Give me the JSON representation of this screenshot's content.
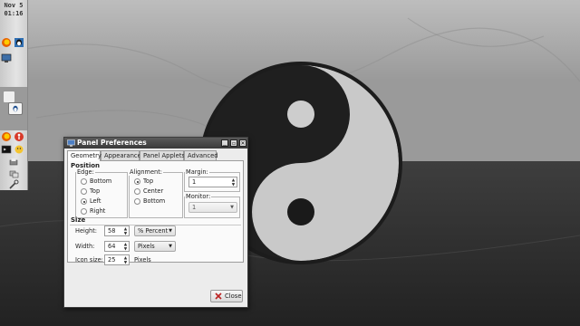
{
  "panel": {
    "clock": {
      "date": "Nov  5",
      "time": "01:16"
    },
    "launchers": [
      {
        "icon": "firefox-icon"
      },
      {
        "icon": "tux-linux-icon"
      },
      {
        "icon": "monitor-icon"
      },
      {
        "icon": "blank-app-icon"
      },
      {
        "icon": "tux-linux-icon"
      },
      {
        "icon": "firefox-icon"
      },
      {
        "icon": "accessibility-icon"
      },
      {
        "icon": "terminal-icon"
      },
      {
        "icon": "settings-tools-icon"
      }
    ]
  },
  "window": {
    "title": "Panel Preferences",
    "tabs": [
      "Geometry",
      "Appearance",
      "Panel Applets",
      "Advanced"
    ],
    "active_tab": "Geometry",
    "position": {
      "heading": "Position",
      "edge": {
        "label": "Edge:",
        "options": [
          "Bottom",
          "Top",
          "Left",
          "Right"
        ],
        "selected": "Left"
      },
      "alignment": {
        "label": "Alignment:",
        "options": [
          "Top",
          "Center",
          "Bottom"
        ],
        "selected": "Top"
      },
      "margin": {
        "label": "Margin:",
        "value": "1"
      },
      "monitor": {
        "label": "Monitor:",
        "value": "1"
      }
    },
    "size": {
      "heading": "Size",
      "height": {
        "label": "Height:",
        "value": "58",
        "unit": "% Percent"
      },
      "width": {
        "label": "Width:",
        "value": "64",
        "unit": "Pixels"
      },
      "icon_size": {
        "label": "Icon size:",
        "value": "25",
        "unit": "Pixels"
      }
    },
    "close_label": "Close"
  },
  "colors": {
    "titlebar": "#3a3a3a",
    "panel": "#d8d8d8",
    "dialog": "#ececec"
  }
}
